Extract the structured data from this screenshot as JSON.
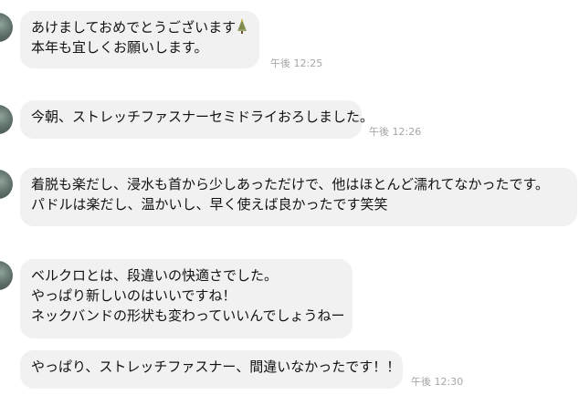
{
  "messages": [
    {
      "lines": [
        "あけましておめでとうございます",
        "本年も宜しくお願いします。"
      ],
      "time": "午後 12:25",
      "trailing_icon": "christmas-tree-icon"
    },
    {
      "lines": [
        "今朝、ストレッチファスナーセミドライおろしました。"
      ],
      "time": "午後 12:26"
    },
    {
      "lines": [
        "着脱も楽だし、浸水も首から少しあっただけで、他はほとんど濡れてなかったです。",
        "パドルは楽だし、温かいし、早く使えば良かったです笑笑"
      ]
    },
    {
      "lines": [
        "ベルクロとは、段違いの快適さでした。",
        "やっぱり新しいのはいいですね！",
        "ネックバンドの形状も変わっていいんでしょうねー"
      ]
    },
    {
      "lines": [
        "やっぱり、ストレッチファスナー、間違いなかったです！！"
      ],
      "time": "午後 12:30"
    }
  ]
}
